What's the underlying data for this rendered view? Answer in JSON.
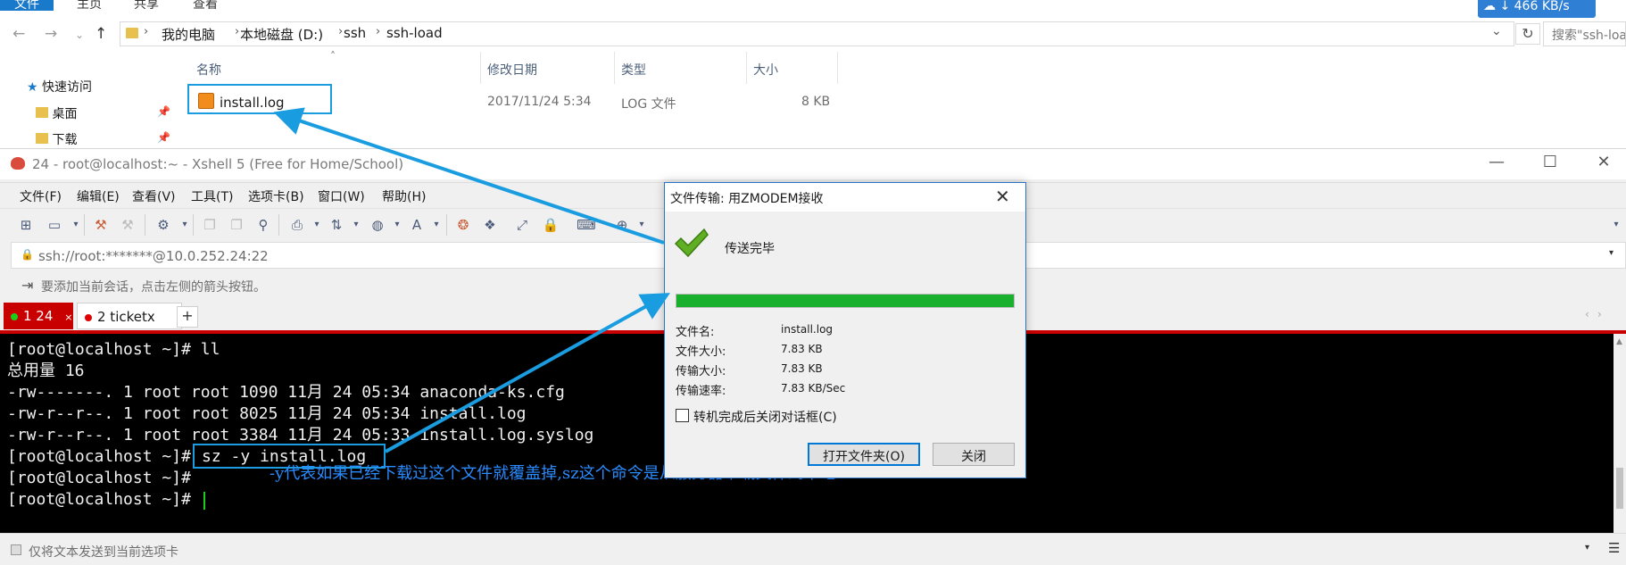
{
  "explorer": {
    "ribbon_tabs": [
      "文件",
      "主页",
      "共享",
      "查看"
    ],
    "breadcrumbs": [
      "我的电脑",
      "本地磁盘 (D:)",
      "ssh",
      "ssh-load"
    ],
    "search_placeholder": "搜索\"ssh-load\"",
    "speed_badge": "466 KB/s",
    "columns": [
      "名称",
      "修改日期",
      "类型",
      "大小"
    ],
    "sidebar": [
      "快速访问",
      "桌面",
      "下载"
    ],
    "file": {
      "name": "install.log",
      "date": "2017/11/24 5:34",
      "type": "LOG 文件",
      "size": "8 KB"
    }
  },
  "xshell": {
    "title": "24 - root@localhost:~ - Xshell 5 (Free for Home/School)",
    "menu": [
      "文件(F)",
      "编辑(E)",
      "查看(V)",
      "工具(T)",
      "选项卡(B)",
      "窗口(W)",
      "帮助(H)"
    ],
    "url": "ssh://root:*******@10.0.252.24:22",
    "hint": "要添加当前会话，点击左侧的箭头按钮。",
    "tabs": [
      {
        "label": "1 24",
        "dot_color": "#19d019"
      },
      {
        "label": "2 ticketx",
        "dot_color": "#e00000"
      }
    ],
    "add_tab": "+",
    "terminal_lines": [
      "[root@localhost ~]# ll",
      "总用量 16",
      "-rw-------. 1 root root 1090 11月 24 05:34 anaconda-ks.cfg",
      "-rw-r--r--. 1 root root 8025 11月 24 05:34 install.log",
      "-rw-r--r--. 1 root root 3384 11月 24 05:33 install.log.syslog",
      "[root@localhost ~]# ",
      "[root@localhost ~]#",
      "[root@localhost ~]# "
    ],
    "highlight_command": "sz -y install.log",
    "annotation": "-y代表如果已经下载过这个文件就覆盖掉,sz这个命令是从服务器下载文件到本地",
    "status": "仅将文本发送到当前选项卡"
  },
  "dialog": {
    "title": "文件传输: 用ZMODEM接收",
    "status": "传送完毕",
    "progress": 1.0,
    "labels": [
      "文件名:",
      "文件大小:",
      "传输大小:",
      "传输速率:"
    ],
    "values": [
      "install.log",
      "7.83 KB",
      "7.83 KB",
      "7.83 KB/Sec"
    ],
    "checkbox_label": "转机完成后关闭对话框(C)",
    "open_folder": "打开文件夹(O)",
    "close": "关闭"
  },
  "colors": {
    "accent": "#1979ca",
    "tab_active": "#c80000",
    "progress": "#18b02d",
    "annotation": "#2a8bff",
    "highlight_box": "#1a9ce0"
  }
}
